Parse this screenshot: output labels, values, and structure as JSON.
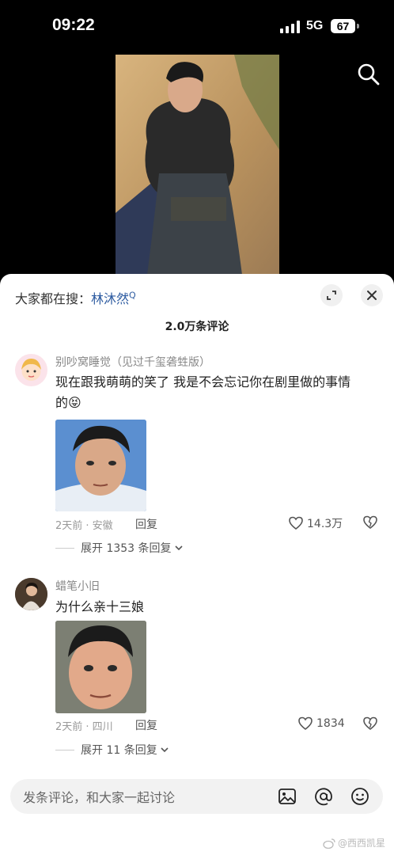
{
  "status_bar": {
    "time": "09:22",
    "network": "5G",
    "battery": "67"
  },
  "sheet": {
    "hot_search_prefix": "大家都在搜：",
    "hot_search_term": "林沐然",
    "comment_count": "2.0万条评论"
  },
  "comments": [
    {
      "username": "别吵窝睡觉（见过千玺砻甡版）",
      "text_line1": "现在跟我萌萌的笑了 我是不会忘记你在剧里做的事情",
      "text_line2": "的",
      "emoji": "😝",
      "meta": "2天前 · 安徽",
      "reply_label": "回复",
      "likes": "14.3万",
      "expand_label": "展开 1353 条回复"
    },
    {
      "username": "蜡笔小旧",
      "text_line1": "为什么亲十三娘",
      "meta": "2天前 · 四川",
      "reply_label": "回复",
      "likes": "1834",
      "expand_label": "展开 11 条回复"
    }
  ],
  "input": {
    "placeholder": "发条评论，和大家一起讨论"
  },
  "watermark": "@西西凯星",
  "colors": {
    "accent_link": "#2c5aa0",
    "sheet_bg": "#ffffff",
    "input_bg": "#f2f2f2"
  },
  "icons": [
    "search-icon",
    "expand-icon",
    "close-icon",
    "heart-icon",
    "broken-heart-icon",
    "chevron-down-icon",
    "image-icon",
    "at-icon",
    "smile-icon"
  ]
}
